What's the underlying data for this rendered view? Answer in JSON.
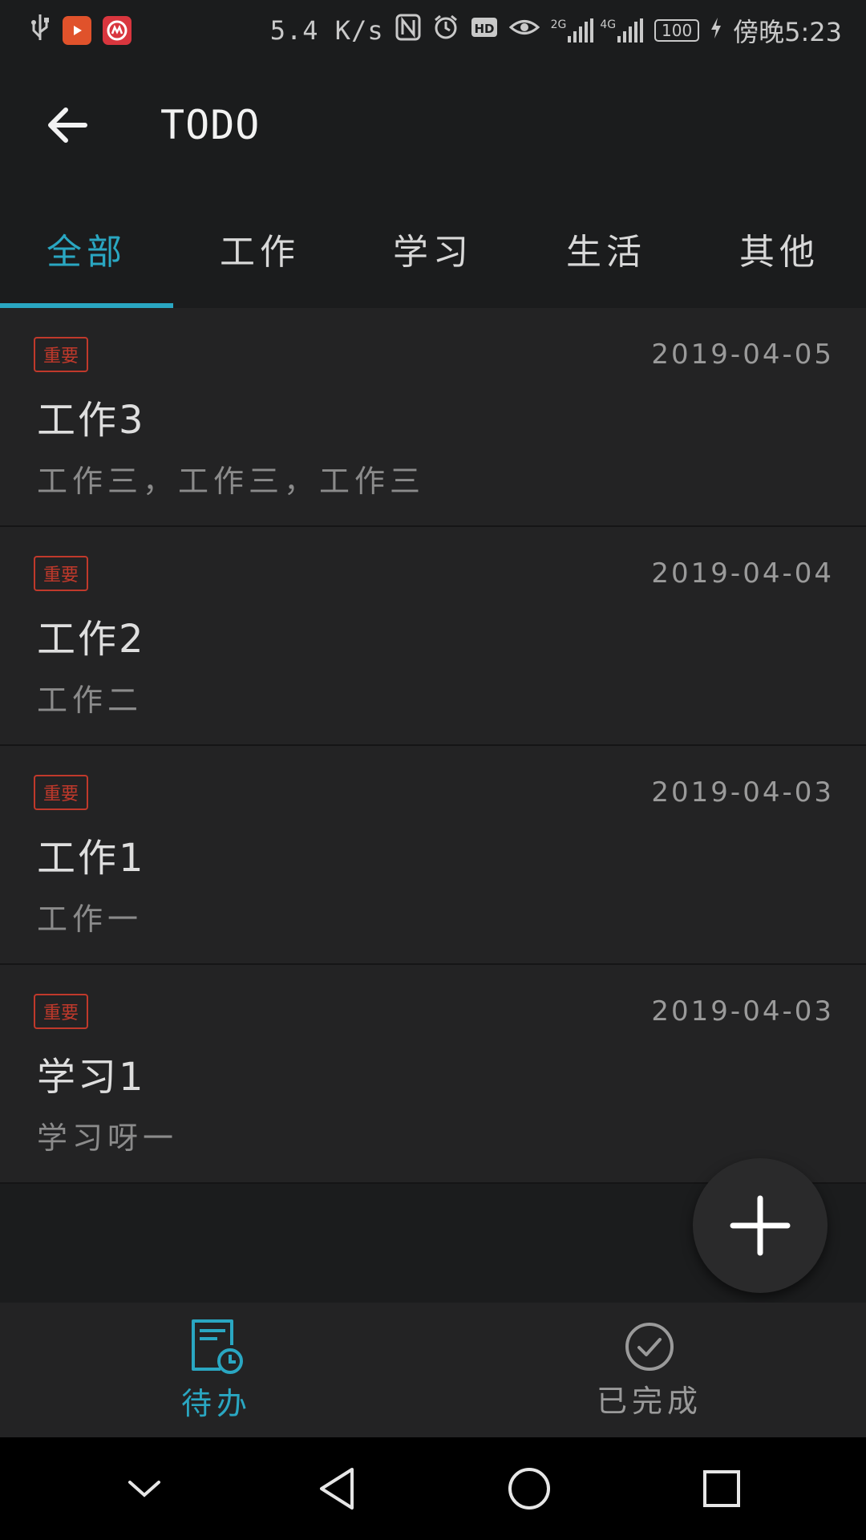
{
  "status_bar": {
    "net_speed": "5.4 K/s",
    "signal_2g": "2G",
    "signal_4g": "4G",
    "battery": "100",
    "time": "傍晚5:23",
    "icons": [
      "usb-icon",
      "video-app-icon",
      "bank-app-icon",
      "nfc-icon",
      "alarm-icon",
      "hd-icon",
      "eye-icon",
      "signal-icon",
      "battery-icon",
      "charging-icon"
    ]
  },
  "app_bar": {
    "back_icon": "arrow-left-icon",
    "title": "TODO"
  },
  "tabs": [
    {
      "label": "全部",
      "active": true
    },
    {
      "label": "工作",
      "active": false
    },
    {
      "label": "学习",
      "active": false
    },
    {
      "label": "生活",
      "active": false
    },
    {
      "label": "其他",
      "active": false
    }
  ],
  "todos": [
    {
      "tag": "重要",
      "date": "2019-04-05",
      "title": "工作3",
      "desc": "工作三，工作三，工作三"
    },
    {
      "tag": "重要",
      "date": "2019-04-04",
      "title": "工作2",
      "desc": "工作二"
    },
    {
      "tag": "重要",
      "date": "2019-04-03",
      "title": "工作1",
      "desc": "工作一"
    },
    {
      "tag": "重要",
      "date": "2019-04-03",
      "title": "学习1",
      "desc": "学习呀一"
    }
  ],
  "fab": {
    "icon": "plus-icon"
  },
  "bottom_nav": [
    {
      "label": "待办",
      "icon": "todo-clock-icon",
      "active": true
    },
    {
      "label": "已完成",
      "icon": "check-circle-icon",
      "active": false
    }
  ],
  "system_nav": [
    "chevron-down-icon",
    "back-triangle-icon",
    "home-circle-icon",
    "recents-square-icon"
  ],
  "colors": {
    "accent": "#2aa7c2",
    "tag_red": "#c0392b",
    "background": "#1b1c1d",
    "card": "#232324"
  }
}
